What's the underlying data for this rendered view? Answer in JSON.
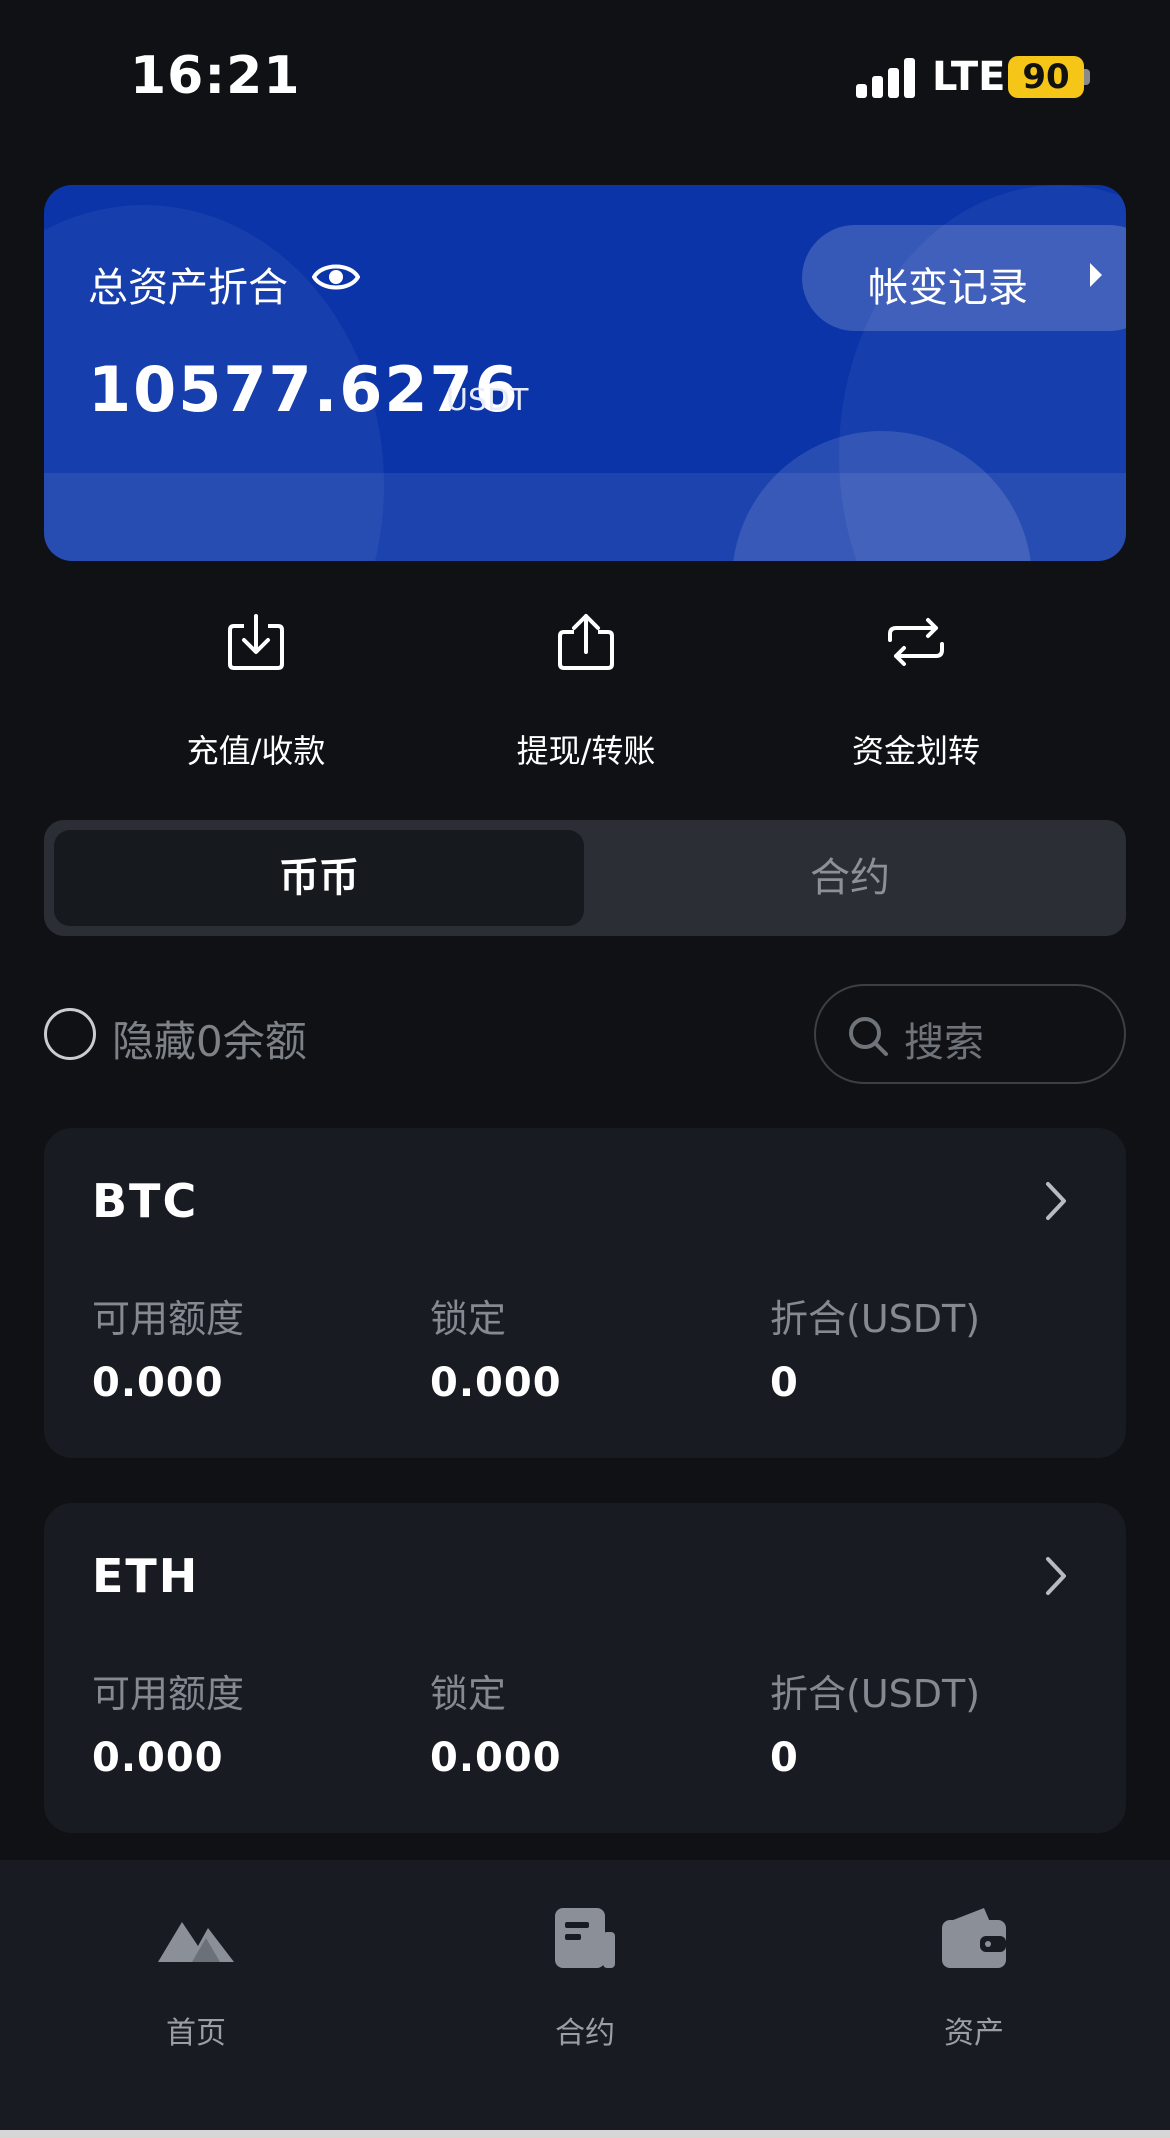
{
  "status_bar": {
    "time": "16:21",
    "network": "LTE",
    "battery": "90"
  },
  "asset_card": {
    "label": "总资产折合",
    "amount": "10577.6276",
    "unit": "USDT",
    "record_button": "帐变记录",
    "eye_icon": "eye-icon",
    "background_color": "#0a34a8"
  },
  "actions": [
    {
      "label": "充值/收款",
      "icon": "deposit-icon"
    },
    {
      "label": "提现/转账",
      "icon": "withdraw-icon"
    },
    {
      "label": "资金划转",
      "icon": "transfer-icon"
    }
  ],
  "segment": {
    "active": "币币",
    "inactive": "合约"
  },
  "filter": {
    "hide_zero_label": "隐藏0余额",
    "search_placeholder": "搜索"
  },
  "coins": [
    {
      "name": "BTC",
      "available_label": "可用额度",
      "available": "0.000",
      "locked_label": "锁定",
      "locked": "0.000",
      "worth_label": "折合(USDT)",
      "worth": "0"
    },
    {
      "name": "ETH",
      "available_label": "可用额度",
      "available": "0.000",
      "locked_label": "锁定",
      "locked": "0.000",
      "worth_label": "折合(USDT)",
      "worth": "0"
    }
  ],
  "bottom_nav": [
    {
      "label": "首页",
      "icon": "home-icon"
    },
    {
      "label": "合约",
      "icon": "contract-icon"
    },
    {
      "label": "资产",
      "icon": "wallet-icon"
    }
  ]
}
